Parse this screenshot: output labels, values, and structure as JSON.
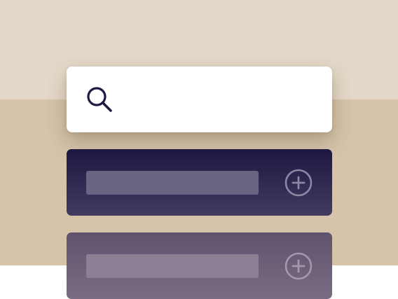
{
  "search": {
    "icon": "search-icon",
    "value": "",
    "placeholder": ""
  },
  "items": [
    {
      "label": "",
      "action_icon": "plus-circle-icon"
    },
    {
      "label": "",
      "action_icon": "plus-circle-icon"
    }
  ],
  "colors": {
    "background_top": "#e4d8c8",
    "background_bottom": "#d5c4a9",
    "search_card": "#ffffff",
    "icon_ink": "#1e1a42",
    "item_row_primary": "#1d1842",
    "item_row_secondary": "#5e526e"
  }
}
